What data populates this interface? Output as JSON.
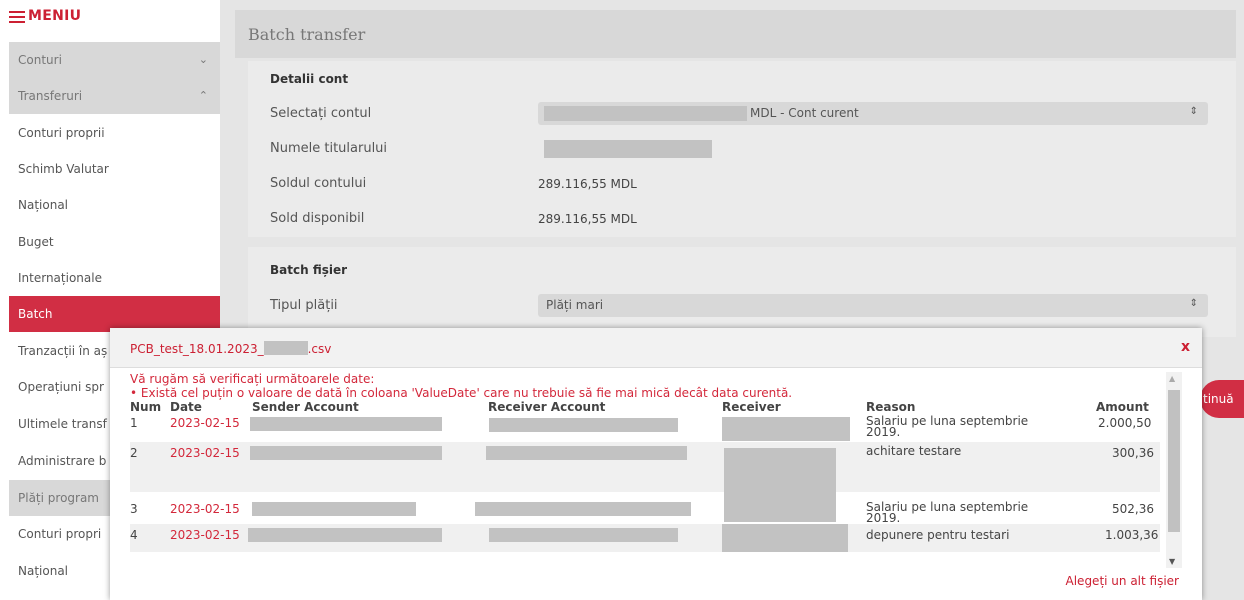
{
  "sidebar": {
    "menu_label": "MENIU",
    "items": [
      {
        "label": "Conturi",
        "chevron": "⌄"
      },
      {
        "label": "Transferuri",
        "chevron": "⌃"
      },
      {
        "label": "Conturi proprii"
      },
      {
        "label": "Schimb Valutar"
      },
      {
        "label": "Național"
      },
      {
        "label": "Buget"
      },
      {
        "label": "Internaționale"
      },
      {
        "label": "Batch"
      },
      {
        "label": "Tranzacții în aș"
      },
      {
        "label": "Operațiuni spr"
      },
      {
        "label": "Ultimele transf"
      },
      {
        "label": "Administrare b"
      },
      {
        "label": "Plăți program"
      },
      {
        "label": "Conturi propri"
      },
      {
        "label": "Național"
      }
    ]
  },
  "header": {
    "title": "Batch transfer"
  },
  "account_details": {
    "title": "Detalii cont",
    "select_account_label": "Selectați contul",
    "select_account_value": "MDL - Cont curent",
    "holder_label": "Numele titularului",
    "balance_label": "Soldul contului",
    "balance_value": "289.116,55 MDL",
    "available_label": "Sold disponibil",
    "available_value": "289.116,55 MDL"
  },
  "batch_file": {
    "title": "Batch fișier",
    "payment_type_label": "Tipul plății",
    "payment_type_value": "Plăți mari"
  },
  "continue_label": "tinuă",
  "modal": {
    "filename_prefix": "PCB_test_18.01.2023_",
    "filename_suffix": ".csv",
    "close_label": "x",
    "warning_line1": "Vă rugăm să verificați următoarele date:",
    "warning_line2": "•  Există cel puțin o valoare de dată în coloana 'ValueDate' care nu trebuie să fie mai mică decât data curentă.",
    "columns": {
      "num": "Num",
      "date": "Date",
      "sender": "Sender Account",
      "receiver_account": "Receiver Account",
      "receiver": "Receiver",
      "reason": "Reason",
      "amount": "Amount"
    },
    "rows": [
      {
        "num": "1",
        "date": "2023-02-15",
        "reason": "Salariu pe luna septembrie 2019.",
        "amount": "2.000,50"
      },
      {
        "num": "2",
        "date": "2023-02-15",
        "reason": "achitare testare",
        "amount": "300,36"
      },
      {
        "num": "3",
        "date": "2023-02-15",
        "reason": "Salariu pe luna septembrie 2019.",
        "amount": "502,36"
      },
      {
        "num": "4",
        "date": "2023-02-15",
        "reason": "depunere pentru testari",
        "amount": "1.003,36"
      }
    ],
    "choose_other_label": "Alegeți un alt fișier"
  },
  "colors": {
    "accent": "#cc2033",
    "active_bg": "#d12e44",
    "redaction": "#c2c2c2"
  }
}
